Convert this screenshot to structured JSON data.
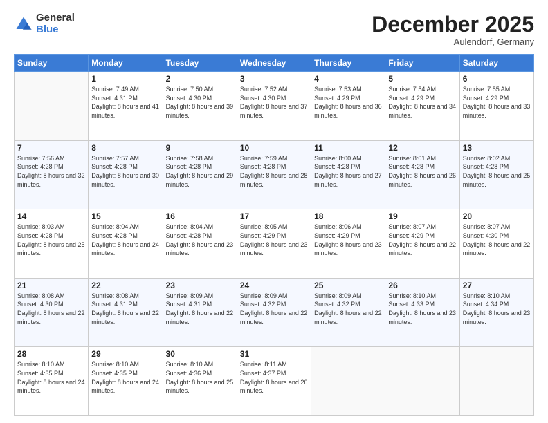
{
  "logo": {
    "general": "General",
    "blue": "Blue"
  },
  "header": {
    "month": "December 2025",
    "location": "Aulendorf, Germany"
  },
  "weekdays": [
    "Sunday",
    "Monday",
    "Tuesday",
    "Wednesday",
    "Thursday",
    "Friday",
    "Saturday"
  ],
  "weeks": [
    [
      {
        "day": "",
        "sunrise": "",
        "sunset": "",
        "daylight": ""
      },
      {
        "day": "1",
        "sunrise": "Sunrise: 7:49 AM",
        "sunset": "Sunset: 4:31 PM",
        "daylight": "Daylight: 8 hours and 41 minutes."
      },
      {
        "day": "2",
        "sunrise": "Sunrise: 7:50 AM",
        "sunset": "Sunset: 4:30 PM",
        "daylight": "Daylight: 8 hours and 39 minutes."
      },
      {
        "day": "3",
        "sunrise": "Sunrise: 7:52 AM",
        "sunset": "Sunset: 4:30 PM",
        "daylight": "Daylight: 8 hours and 37 minutes."
      },
      {
        "day": "4",
        "sunrise": "Sunrise: 7:53 AM",
        "sunset": "Sunset: 4:29 PM",
        "daylight": "Daylight: 8 hours and 36 minutes."
      },
      {
        "day": "5",
        "sunrise": "Sunrise: 7:54 AM",
        "sunset": "Sunset: 4:29 PM",
        "daylight": "Daylight: 8 hours and 34 minutes."
      },
      {
        "day": "6",
        "sunrise": "Sunrise: 7:55 AM",
        "sunset": "Sunset: 4:29 PM",
        "daylight": "Daylight: 8 hours and 33 minutes."
      }
    ],
    [
      {
        "day": "7",
        "sunrise": "Sunrise: 7:56 AM",
        "sunset": "Sunset: 4:28 PM",
        "daylight": "Daylight: 8 hours and 32 minutes."
      },
      {
        "day": "8",
        "sunrise": "Sunrise: 7:57 AM",
        "sunset": "Sunset: 4:28 PM",
        "daylight": "Daylight: 8 hours and 30 minutes."
      },
      {
        "day": "9",
        "sunrise": "Sunrise: 7:58 AM",
        "sunset": "Sunset: 4:28 PM",
        "daylight": "Daylight: 8 hours and 29 minutes."
      },
      {
        "day": "10",
        "sunrise": "Sunrise: 7:59 AM",
        "sunset": "Sunset: 4:28 PM",
        "daylight": "Daylight: 8 hours and 28 minutes."
      },
      {
        "day": "11",
        "sunrise": "Sunrise: 8:00 AM",
        "sunset": "Sunset: 4:28 PM",
        "daylight": "Daylight: 8 hours and 27 minutes."
      },
      {
        "day": "12",
        "sunrise": "Sunrise: 8:01 AM",
        "sunset": "Sunset: 4:28 PM",
        "daylight": "Daylight: 8 hours and 26 minutes."
      },
      {
        "day": "13",
        "sunrise": "Sunrise: 8:02 AM",
        "sunset": "Sunset: 4:28 PM",
        "daylight": "Daylight: 8 hours and 25 minutes."
      }
    ],
    [
      {
        "day": "14",
        "sunrise": "Sunrise: 8:03 AM",
        "sunset": "Sunset: 4:28 PM",
        "daylight": "Daylight: 8 hours and 25 minutes."
      },
      {
        "day": "15",
        "sunrise": "Sunrise: 8:04 AM",
        "sunset": "Sunset: 4:28 PM",
        "daylight": "Daylight: 8 hours and 24 minutes."
      },
      {
        "day": "16",
        "sunrise": "Sunrise: 8:04 AM",
        "sunset": "Sunset: 4:28 PM",
        "daylight": "Daylight: 8 hours and 23 minutes."
      },
      {
        "day": "17",
        "sunrise": "Sunrise: 8:05 AM",
        "sunset": "Sunset: 4:29 PM",
        "daylight": "Daylight: 8 hours and 23 minutes."
      },
      {
        "day": "18",
        "sunrise": "Sunrise: 8:06 AM",
        "sunset": "Sunset: 4:29 PM",
        "daylight": "Daylight: 8 hours and 23 minutes."
      },
      {
        "day": "19",
        "sunrise": "Sunrise: 8:07 AM",
        "sunset": "Sunset: 4:29 PM",
        "daylight": "Daylight: 8 hours and 22 minutes."
      },
      {
        "day": "20",
        "sunrise": "Sunrise: 8:07 AM",
        "sunset": "Sunset: 4:30 PM",
        "daylight": "Daylight: 8 hours and 22 minutes."
      }
    ],
    [
      {
        "day": "21",
        "sunrise": "Sunrise: 8:08 AM",
        "sunset": "Sunset: 4:30 PM",
        "daylight": "Daylight: 8 hours and 22 minutes."
      },
      {
        "day": "22",
        "sunrise": "Sunrise: 8:08 AM",
        "sunset": "Sunset: 4:31 PM",
        "daylight": "Daylight: 8 hours and 22 minutes."
      },
      {
        "day": "23",
        "sunrise": "Sunrise: 8:09 AM",
        "sunset": "Sunset: 4:31 PM",
        "daylight": "Daylight: 8 hours and 22 minutes."
      },
      {
        "day": "24",
        "sunrise": "Sunrise: 8:09 AM",
        "sunset": "Sunset: 4:32 PM",
        "daylight": "Daylight: 8 hours and 22 minutes."
      },
      {
        "day": "25",
        "sunrise": "Sunrise: 8:09 AM",
        "sunset": "Sunset: 4:32 PM",
        "daylight": "Daylight: 8 hours and 22 minutes."
      },
      {
        "day": "26",
        "sunrise": "Sunrise: 8:10 AM",
        "sunset": "Sunset: 4:33 PM",
        "daylight": "Daylight: 8 hours and 23 minutes."
      },
      {
        "day": "27",
        "sunrise": "Sunrise: 8:10 AM",
        "sunset": "Sunset: 4:34 PM",
        "daylight": "Daylight: 8 hours and 23 minutes."
      }
    ],
    [
      {
        "day": "28",
        "sunrise": "Sunrise: 8:10 AM",
        "sunset": "Sunset: 4:35 PM",
        "daylight": "Daylight: 8 hours and 24 minutes."
      },
      {
        "day": "29",
        "sunrise": "Sunrise: 8:10 AM",
        "sunset": "Sunset: 4:35 PM",
        "daylight": "Daylight: 8 hours and 24 minutes."
      },
      {
        "day": "30",
        "sunrise": "Sunrise: 8:10 AM",
        "sunset": "Sunset: 4:36 PM",
        "daylight": "Daylight: 8 hours and 25 minutes."
      },
      {
        "day": "31",
        "sunrise": "Sunrise: 8:11 AM",
        "sunset": "Sunset: 4:37 PM",
        "daylight": "Daylight: 8 hours and 26 minutes."
      },
      {
        "day": "",
        "sunrise": "",
        "sunset": "",
        "daylight": ""
      },
      {
        "day": "",
        "sunrise": "",
        "sunset": "",
        "daylight": ""
      },
      {
        "day": "",
        "sunrise": "",
        "sunset": "",
        "daylight": ""
      }
    ]
  ]
}
